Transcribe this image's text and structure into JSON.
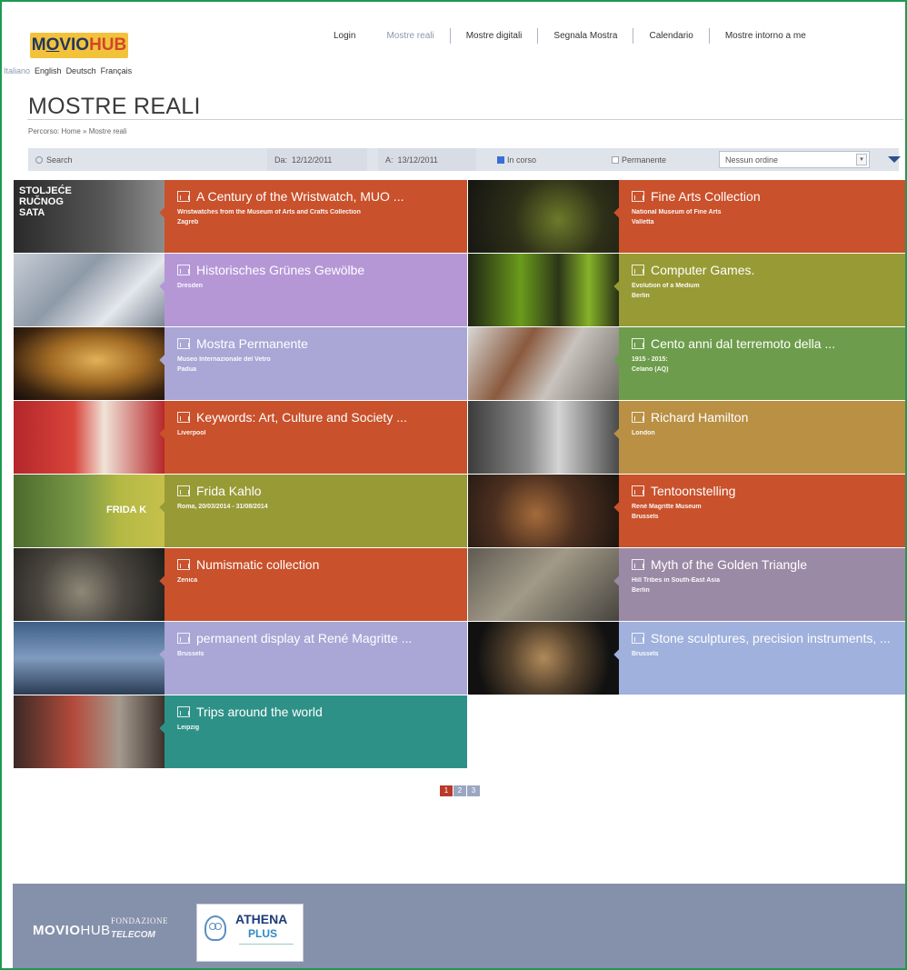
{
  "header": {
    "logo_text": {
      "a": "M",
      "b": "O",
      "c": "VIO",
      "d": "HUB"
    },
    "languages": [
      "Italiano",
      "English",
      "Deutsch",
      "Français"
    ],
    "nav": [
      "Login",
      "Mostre reali",
      "Mostre digitali",
      "Segnala Mostra",
      "Calendario",
      "Mostre intorno a me"
    ]
  },
  "page": {
    "title": "MOSTRE REALI",
    "breadcrumb": "Percorso: Home » Mostre reali"
  },
  "filters": {
    "search_placeholder": "Search",
    "from_label": "Da:",
    "from_value": "12/12/2011",
    "to_label": "A:",
    "to_value": "13/12/2011",
    "in_corso_label": "In corso",
    "in_corso_checked": true,
    "permanente_label": "Permanente",
    "permanente_checked": false,
    "order_value": "Nessun ordine"
  },
  "exhibitions": [
    {
      "title": "A Century of the Wristwatch, MUO ...",
      "subtitle": "Wristwatches from the Museum of Arts and Crafts Collection",
      "place": "Zagreb",
      "color": "#c9512b",
      "thumb_text": "STOLJEĆE RUČNOG SATA"
    },
    {
      "title": "Fine Arts Collection",
      "subtitle": "National Museum of Fine Arts",
      "place": "Valletta",
      "color": "#c9512b",
      "thumb_text": ""
    },
    {
      "title": "Historisches Grünes Gewölbe",
      "subtitle": "",
      "place": "Dresden",
      "color": "#b597d6",
      "thumb_text": ""
    },
    {
      "title": "Computer Games.",
      "subtitle": "Evolution of a Medium",
      "place": "Berlin",
      "color": "#989a35",
      "thumb_text": ""
    },
    {
      "title": "Mostra Permanente",
      "subtitle": "Museo Internazionale del Vetro",
      "place": "Padua",
      "color": "#aaa6d6",
      "thumb_text": ""
    },
    {
      "title": "Cento anni dal terremoto della ...",
      "subtitle": "1915 - 2015:",
      "place": "Celano (AQ)",
      "color": "#6d9d4c",
      "thumb_text": ""
    },
    {
      "title": "Keywords: Art, Culture and Society ...",
      "subtitle": "",
      "place": "Liverpool",
      "color": "#c9512b",
      "thumb_text": ""
    },
    {
      "title": "Richard Hamilton",
      "subtitle": "",
      "place": "London",
      "color": "#b99044",
      "thumb_text": ""
    },
    {
      "title": "Frida Kahlo",
      "subtitle": "Roma, 20/03/2014 - 31/08/2014",
      "place": "",
      "color": "#989a35",
      "thumb_text": "FRIDA K"
    },
    {
      "title": "Tentoonstelling",
      "subtitle": "René Magritte Museum",
      "place": "Brussels",
      "color": "#c9512b",
      "thumb_text": ""
    },
    {
      "title": "Numismatic collection",
      "subtitle": "",
      "place": "Zenica",
      "color": "#c9512b",
      "thumb_text": ""
    },
    {
      "title": "Myth of the Golden Triangle",
      "subtitle": "Hill Tribes in South-East Asia",
      "place": "Berlin",
      "color": "#9b8aa5",
      "thumb_text": ""
    },
    {
      "title": "permanent display at René Magritte ...",
      "subtitle": "",
      "place": "Brussels",
      "color": "#aaa6d6",
      "thumb_text": ""
    },
    {
      "title": "Stone sculptures, precision instruments, ...",
      "subtitle": "",
      "place": "Brussels",
      "color": "#9fb1dc",
      "thumb_text": ""
    },
    {
      "title": "Trips around the world",
      "subtitle": "",
      "place": "Leipzig",
      "color": "#2e9187",
      "thumb_text": ""
    }
  ],
  "pagination": {
    "pages": [
      "1",
      "2",
      "3"
    ],
    "active": "1"
  },
  "footer": {
    "logo1_bold": "MOVIO",
    "logo1_thin": "HUB",
    "fondazione": "FONDAZIONE",
    "telecom": "TELECOM",
    "athena": "ATHENA",
    "plus": "PLUS"
  }
}
